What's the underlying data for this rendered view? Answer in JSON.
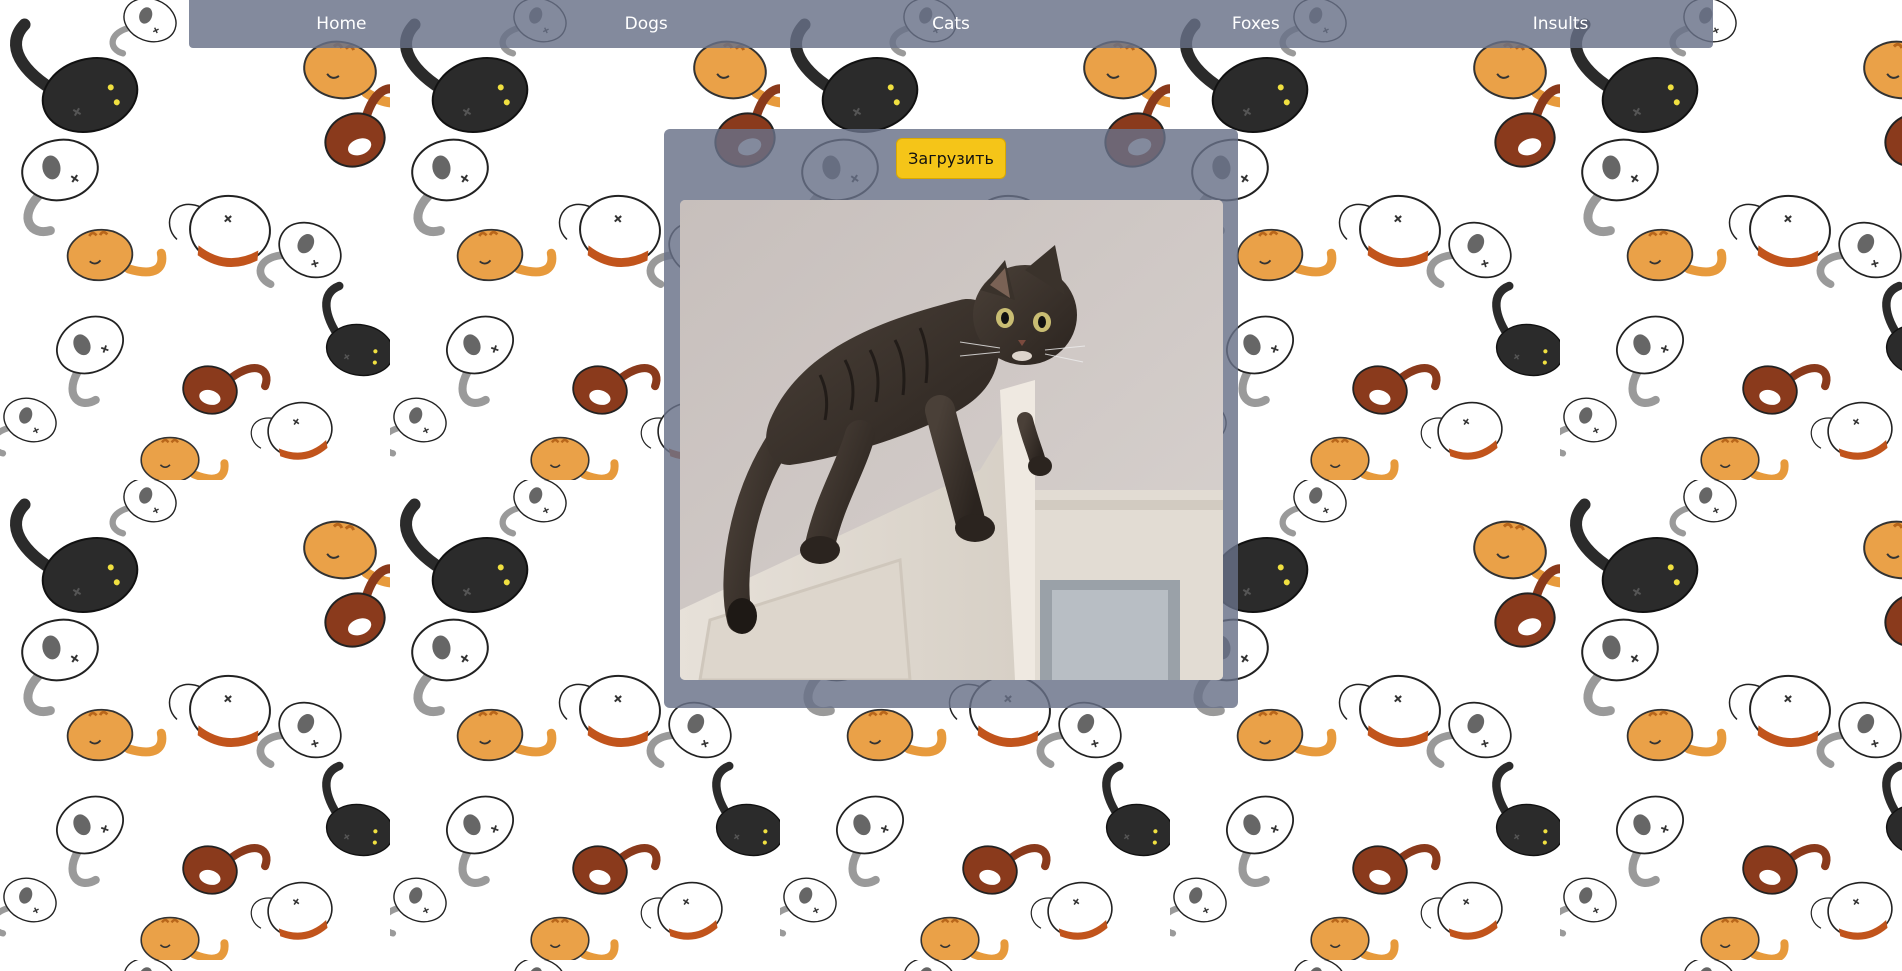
{
  "nav": {
    "items": [
      {
        "label": "Home"
      },
      {
        "label": "Dogs"
      },
      {
        "label": "Cats"
      },
      {
        "label": "Foxes"
      },
      {
        "label": "Insults"
      }
    ]
  },
  "main": {
    "upload_label": "Загрузить",
    "image": "cat-photo"
  },
  "background": {
    "pattern": "cartoon-cats",
    "colors": [
      "#2a2a2a",
      "#e79a3c",
      "#8a3a1c",
      "#ffffff"
    ]
  },
  "colors": {
    "navbar": "#687088",
    "button": "#f5c518"
  }
}
